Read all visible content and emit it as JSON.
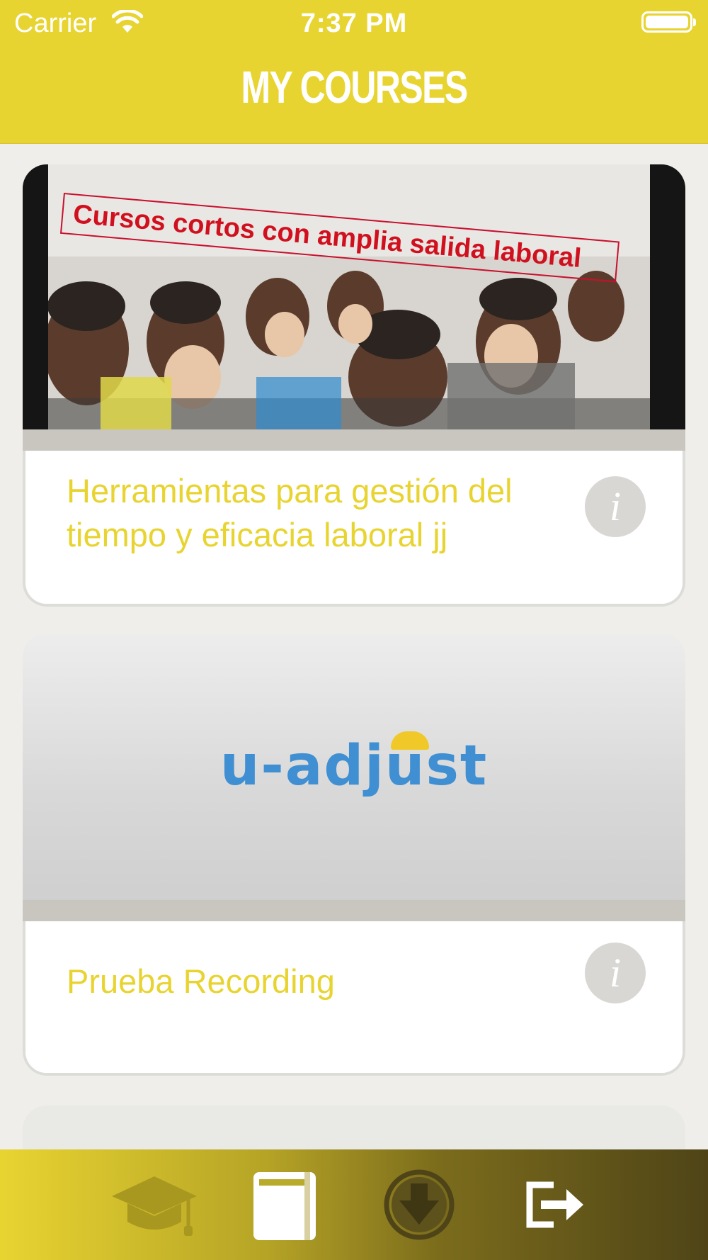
{
  "status_bar": {
    "carrier": "Carrier",
    "time": "7:37 PM"
  },
  "header": {
    "title": "MY COURSES"
  },
  "courses": [
    {
      "image_banner_text": "Cursos cortos con amplia salida laboral",
      "title": "Herramientas para gestión del tiempo y eficacia laboral  jj",
      "info_glyph": "i"
    },
    {
      "logo_text": "u-adjust",
      "title": "Prueba Recording",
      "info_glyph": "i"
    }
  ],
  "tab_bar": {
    "items": [
      {
        "icon": "graduation-cap-icon",
        "active": false
      },
      {
        "icon": "notebook-icon",
        "active": true
      },
      {
        "icon": "download-icon",
        "active": false
      },
      {
        "icon": "logout-icon",
        "active": false
      }
    ]
  },
  "colors": {
    "accent": "#e8d431",
    "logo_blue": "#3f8fd2",
    "background": "#efeeea"
  }
}
